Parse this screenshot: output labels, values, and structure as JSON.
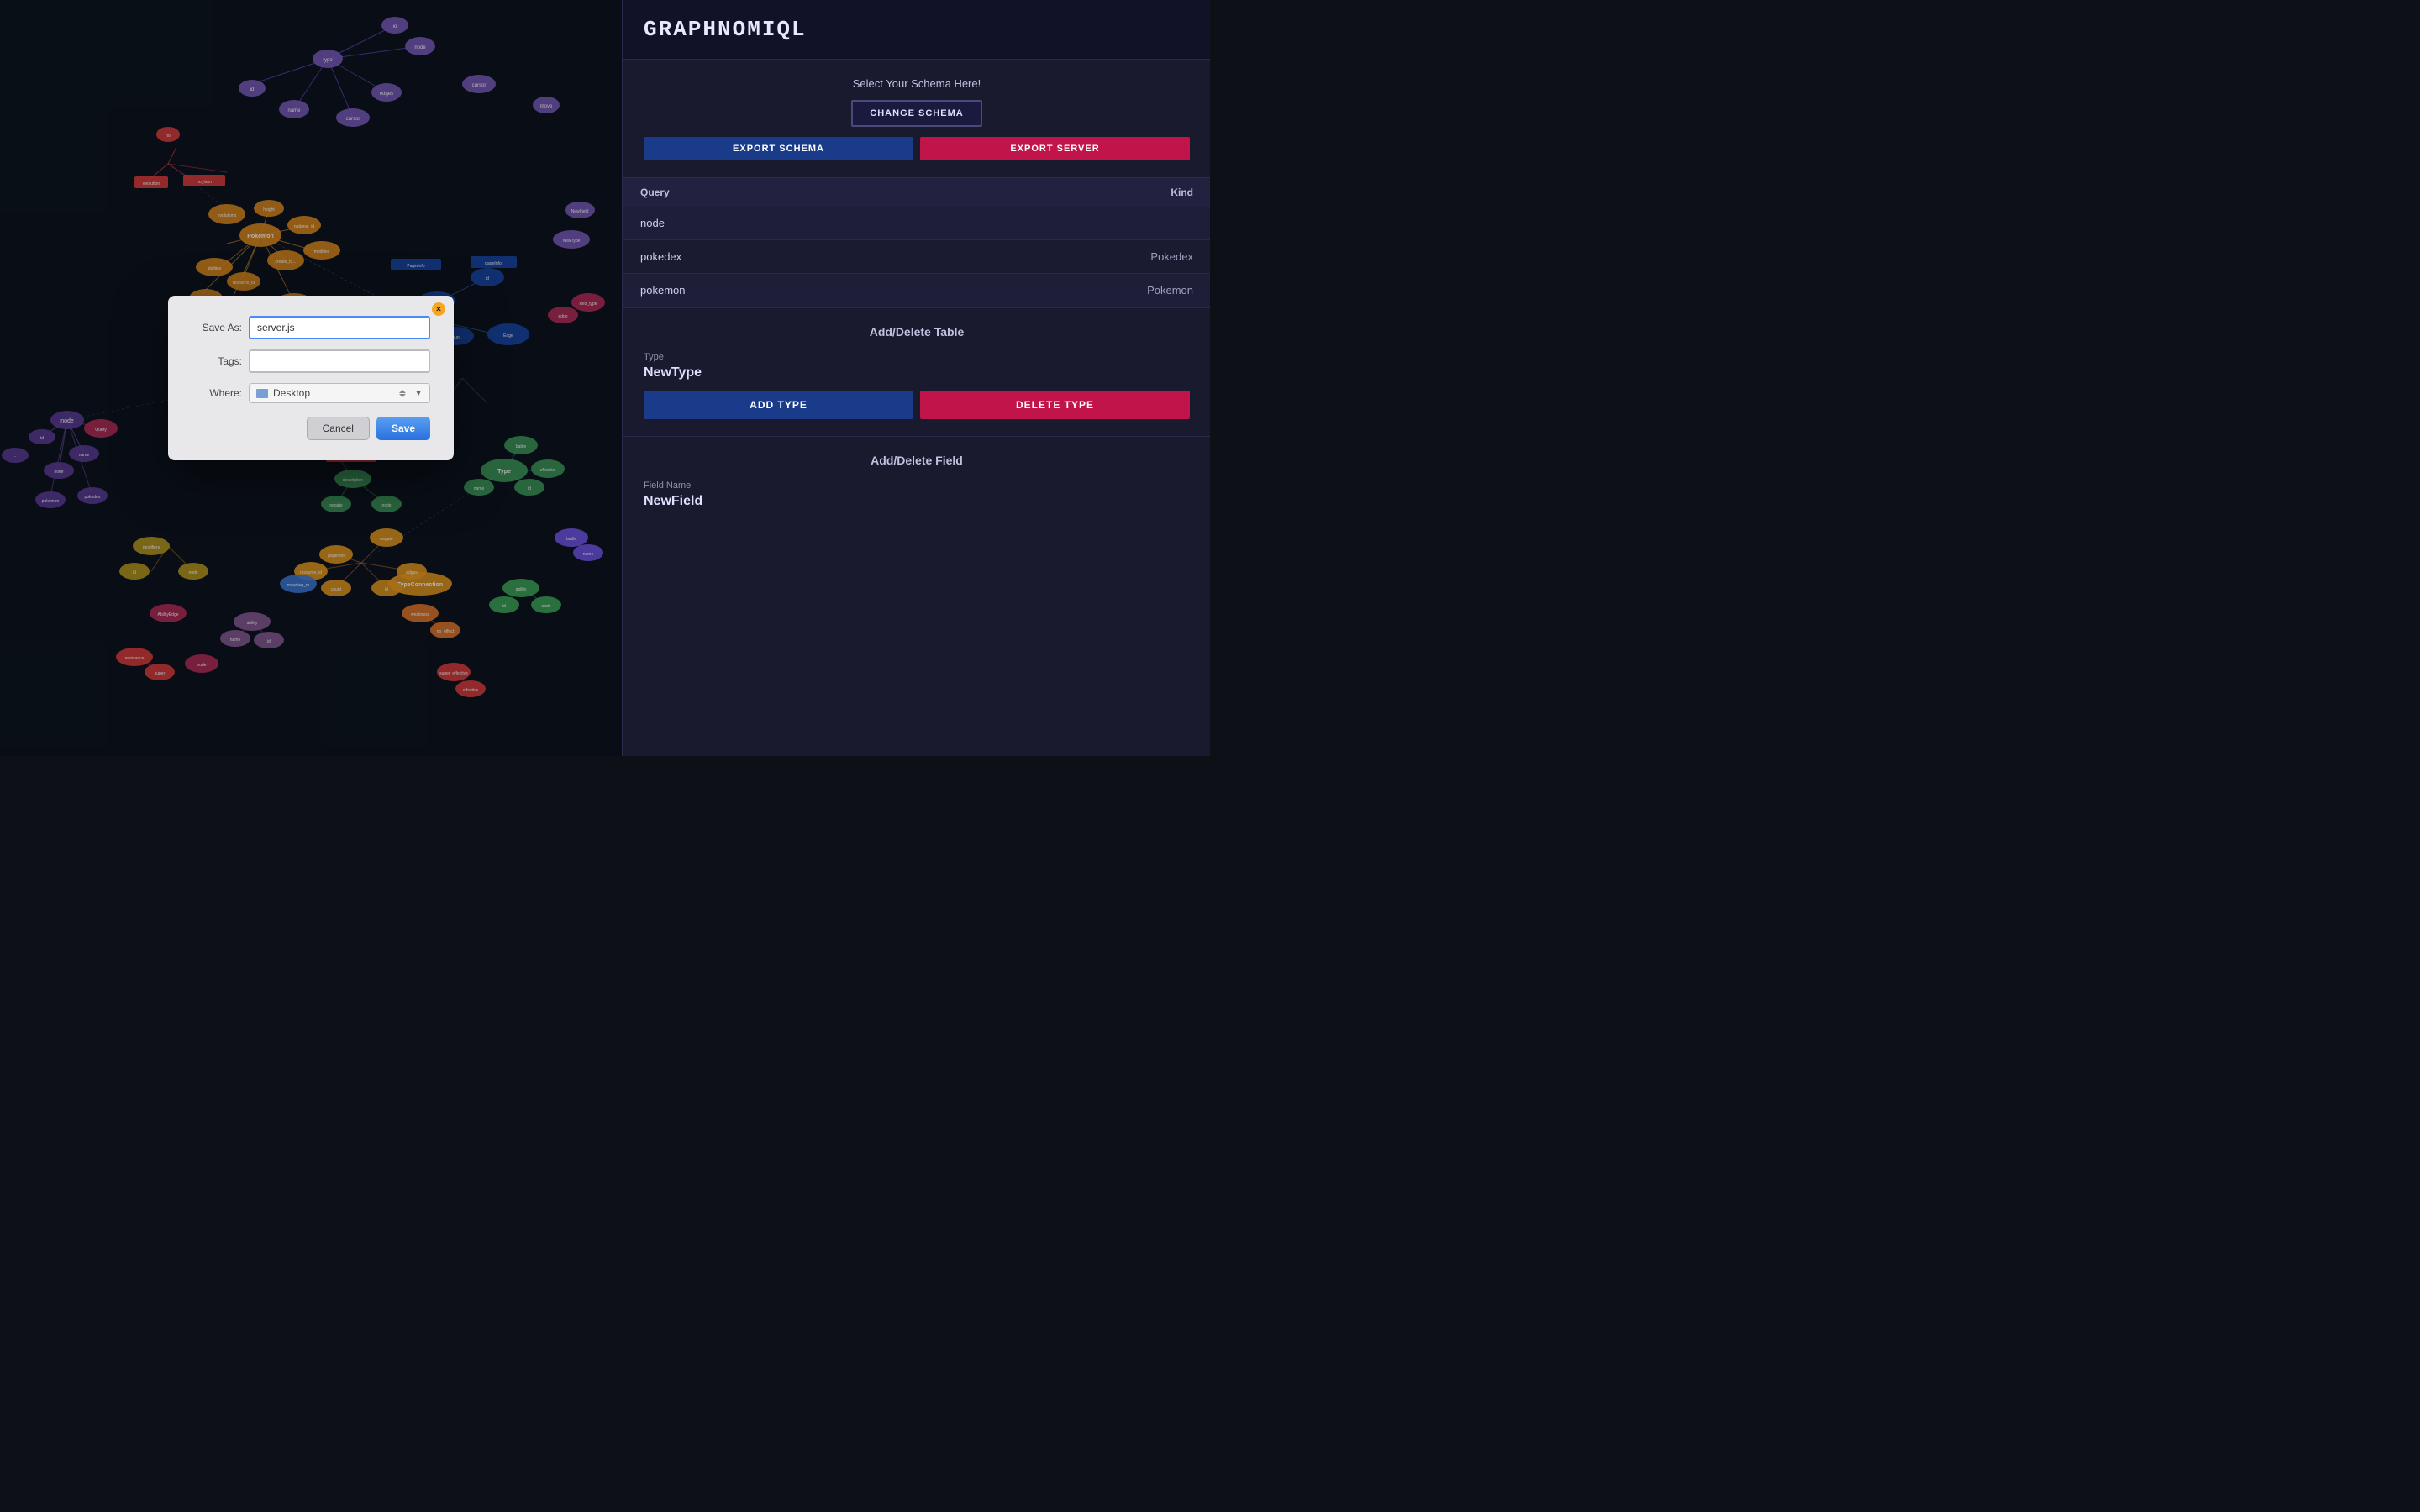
{
  "app": {
    "title": "GRAPHNOMIQL"
  },
  "sidebar": {
    "schema_label": "Select Your Schema Here!",
    "change_schema_btn": "CHANGE SCHEMA",
    "export_schema_btn": "EXPORT SCHEMA",
    "export_server_btn": "EXPORT SERVER"
  },
  "query_table": {
    "col_query": "Query",
    "col_kind": "Kind",
    "rows": [
      {
        "query": "node",
        "kind": ""
      },
      {
        "query": "pokedex",
        "kind": "Pokedex"
      },
      {
        "query": "pokemon",
        "kind": "Pokemon"
      }
    ]
  },
  "add_delete_table": {
    "section_title": "Add/Delete Table",
    "type_label": "Type",
    "type_value": "NewType",
    "add_btn": "ADD TYPE",
    "delete_btn": "DELETE TYPE"
  },
  "add_delete_field": {
    "section_title": "Add/Delete Field",
    "field_name_label": "Field Name",
    "field_name_value": "NewField"
  },
  "save_dialog": {
    "save_as_label": "Save As:",
    "save_as_value": "server.js",
    "tags_label": "Tags:",
    "tags_value": "",
    "where_label": "Where:",
    "where_value": "Desktop",
    "cancel_btn": "Cancel",
    "save_btn": "Save"
  },
  "colors": {
    "accent_blue": "#1a3a8a",
    "accent_red": "#c0144a",
    "dialog_input_border": "#4a8af4"
  }
}
